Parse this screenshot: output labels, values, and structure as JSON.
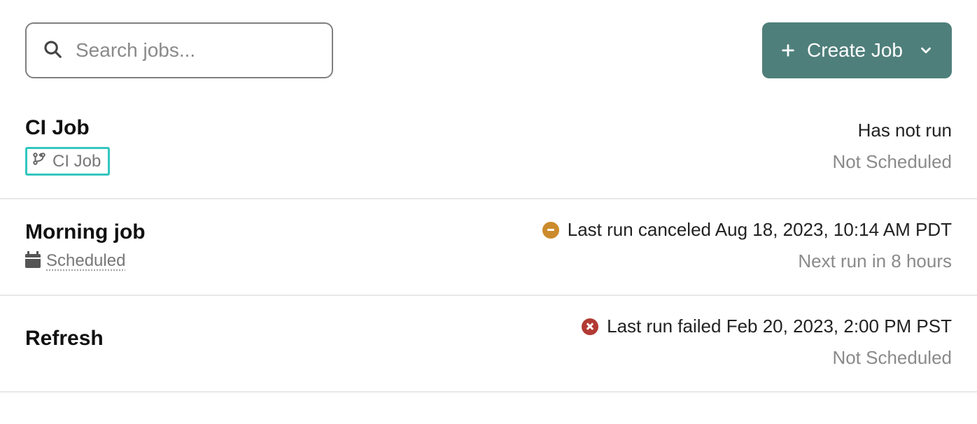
{
  "toolbar": {
    "search_placeholder": "Search jobs...",
    "create_label": "Create Job"
  },
  "jobs": [
    {
      "title": "CI Job",
      "tag_type": "ci",
      "tag_label": "CI Job",
      "status_text": "Has not run",
      "status_kind": "none",
      "sched_text": "Not Scheduled"
    },
    {
      "title": "Morning job",
      "tag_type": "scheduled",
      "tag_label": "Scheduled",
      "status_text": "Last run canceled Aug 18, 2023, 10:14 AM PDT",
      "status_kind": "canceled",
      "sched_text": "Next run in 8 hours"
    },
    {
      "title": "Refresh",
      "tag_type": "none",
      "tag_label": "",
      "status_text": "Last run failed Feb 20, 2023, 2:00 PM PST",
      "status_kind": "failed",
      "sched_text": "Not Scheduled"
    }
  ],
  "colors": {
    "accent": "#4f7f7b",
    "ci_tag_border": "#33c6bf",
    "canceled": "#cc8b2c",
    "failed": "#b23a33"
  }
}
